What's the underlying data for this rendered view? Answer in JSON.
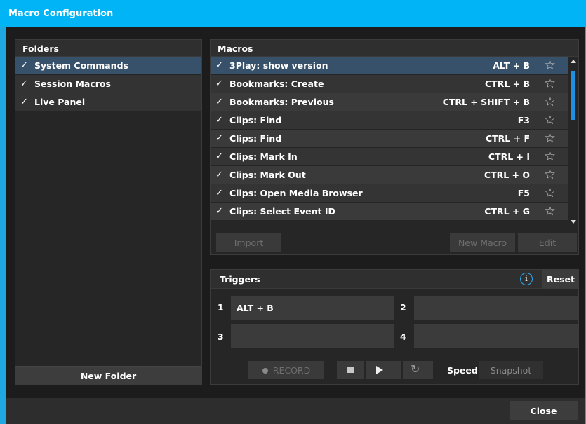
{
  "window": {
    "title": "Macro Configuration"
  },
  "folders": {
    "header": "Folders",
    "items": [
      {
        "label": "System Commands",
        "checked": "✓",
        "selected": true
      },
      {
        "label": "Session Macros",
        "checked": "✓",
        "selected": false
      },
      {
        "label": "Live Panel",
        "checked": "✓",
        "selected": false
      }
    ],
    "new_folder_label": "New Folder"
  },
  "macros": {
    "header": "Macros",
    "items": [
      {
        "label": "3Play: show version",
        "keys": "ALT + B",
        "checked": "✓",
        "selected": true
      },
      {
        "label": "Bookmarks: Create",
        "keys": "CTRL + B",
        "checked": "✓",
        "selected": false
      },
      {
        "label": "Bookmarks: Previous",
        "keys": "CTRL + SHIFT + B",
        "checked": "✓",
        "selected": false
      },
      {
        "label": "Clips: Find",
        "keys": "F3",
        "checked": "✓",
        "selected": false
      },
      {
        "label": "Clips: Find",
        "keys": "CTRL + F",
        "checked": "✓",
        "selected": false
      },
      {
        "label": "Clips: Mark In",
        "keys": "CTRL + I",
        "checked": "✓",
        "selected": false
      },
      {
        "label": "Clips: Mark Out",
        "keys": "CTRL + O",
        "checked": "✓",
        "selected": false
      },
      {
        "label": "Clips: Open Media Browser",
        "keys": "F5",
        "checked": "✓",
        "selected": false
      },
      {
        "label": "Clips: Select Event ID",
        "keys": "CTRL + G",
        "checked": "✓",
        "selected": false
      }
    ],
    "import_label": "Import",
    "new_macro_label": "New Macro",
    "edit_label": "Edit"
  },
  "triggers": {
    "header": "Triggers",
    "info_glyph": "i",
    "reset_label": "Reset",
    "slots": [
      {
        "num": "1",
        "value": "ALT + B"
      },
      {
        "num": "2",
        "value": ""
      },
      {
        "num": "3",
        "value": ""
      },
      {
        "num": "4",
        "value": ""
      }
    ],
    "record_label": "RECORD",
    "speed_label": "Speed",
    "speed_value": "Snapshot",
    "loop_glyph": "↻"
  },
  "footer": {
    "close_label": "Close"
  },
  "colors": {
    "accent": "#00b4f5",
    "selection": "#37516a",
    "scroll_thumb": "#1f8fe0"
  }
}
